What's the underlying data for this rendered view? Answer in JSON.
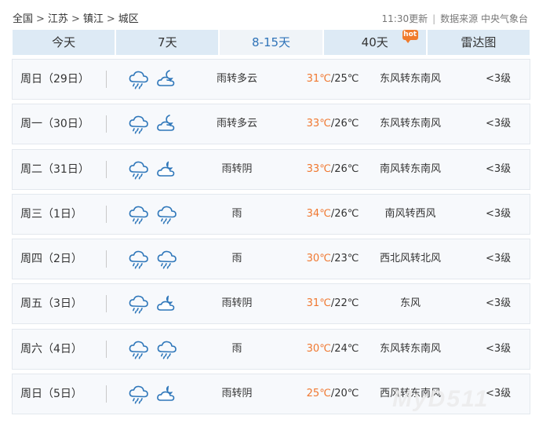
{
  "breadcrumb": [
    "全国",
    "江苏",
    "镇江",
    "城区"
  ],
  "source": {
    "updated": "11:30更新",
    "label": "数据来源 中央气象台"
  },
  "tabs": [
    {
      "label": "今天",
      "active": false
    },
    {
      "label": "7天",
      "active": false
    },
    {
      "label": "8-15天",
      "active": true
    },
    {
      "label": "40天",
      "active": false,
      "badge": "hot"
    },
    {
      "label": "雷达图",
      "active": false
    }
  ],
  "colors": {
    "accent": "#2f73b8",
    "high_temp": "#f07830",
    "tab_bg": "#ddeaf5",
    "icon": "#2f77ba"
  },
  "days": [
    {
      "day": "周日（29日）",
      "icons": [
        "rain-icon",
        "partly-cloudy-night-icon"
      ],
      "desc": "雨转多云",
      "high": "31℃",
      "low": "/25℃",
      "wind": "东风转东南风",
      "level": "<3级"
    },
    {
      "day": "周一（30日）",
      "icons": [
        "rain-icon",
        "partly-cloudy-night-icon"
      ],
      "desc": "雨转多云",
      "high": "33℃",
      "low": "/26℃",
      "wind": "东风转东南风",
      "level": "<3级"
    },
    {
      "day": "周二（31日）",
      "icons": [
        "rain-icon",
        "overcast-icon"
      ],
      "desc": "雨转阴",
      "high": "33℃",
      "low": "/26℃",
      "wind": "南风转东南风",
      "level": "<3级"
    },
    {
      "day": "周三（1日）",
      "icons": [
        "rain-icon",
        "rain-icon"
      ],
      "desc": "雨",
      "high": "34℃",
      "low": "/26℃",
      "wind": "南风转西风",
      "level": "<3级"
    },
    {
      "day": "周四（2日）",
      "icons": [
        "rain-icon",
        "rain-icon"
      ],
      "desc": "雨",
      "high": "30℃",
      "low": "/23℃",
      "wind": "西北风转北风",
      "level": "<3级"
    },
    {
      "day": "周五（3日）",
      "icons": [
        "rain-icon",
        "overcast-icon"
      ],
      "desc": "雨转阴",
      "high": "31℃",
      "low": "/22℃",
      "wind": "东风",
      "level": "<3级"
    },
    {
      "day": "周六（4日）",
      "icons": [
        "rain-icon",
        "rain-icon"
      ],
      "desc": "雨",
      "high": "30℃",
      "low": "/24℃",
      "wind": "东风转东南风",
      "level": "<3级"
    },
    {
      "day": "周日（5日）",
      "icons": [
        "rain-icon",
        "overcast-icon"
      ],
      "desc": "雨转阴",
      "high": "25℃",
      "low": "/20℃",
      "wind": "西风转东南风",
      "level": "<3级"
    }
  ],
  "watermark": "MyD511"
}
